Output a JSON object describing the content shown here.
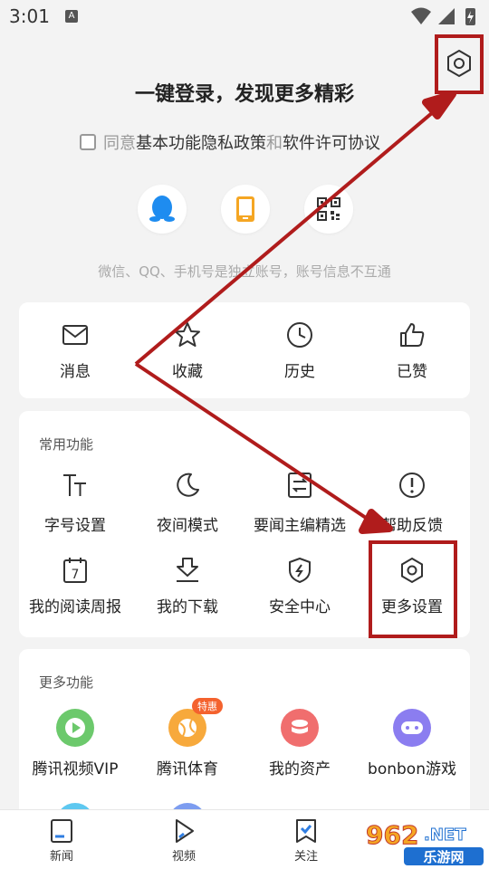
{
  "status_bar": {
    "time": "3:01",
    "notif_letter": "A"
  },
  "login": {
    "title": "一键登录，发现更多精彩",
    "agree_prefix": "同意",
    "agree_link1": "基本功能隐私政策",
    "agree_and": "和",
    "agree_link2": "软件许可协议",
    "methods": [
      {
        "name": "qq",
        "icon": "qq-penguin-icon",
        "color": "#1e8cf0"
      },
      {
        "name": "phone",
        "icon": "phone-icon",
        "color": "#f5a623"
      },
      {
        "name": "qr",
        "icon": "qr-code-icon",
        "color": "#333333"
      }
    ],
    "note": "微信、QQ、手机号是独立账号，账号信息不互通"
  },
  "quick": [
    {
      "label": "消息",
      "icon": "mail-icon"
    },
    {
      "label": "收藏",
      "icon": "star-icon"
    },
    {
      "label": "历史",
      "icon": "clock-icon"
    },
    {
      "label": "已赞",
      "icon": "thumbs-up-icon"
    }
  ],
  "common": {
    "title": "常用功能",
    "items": [
      {
        "label": "字号设置",
        "icon": "font-size-icon"
      },
      {
        "label": "夜间模式",
        "icon": "moon-icon"
      },
      {
        "label": "要闻主编精选",
        "icon": "swap-list-icon"
      },
      {
        "label": "帮助反馈",
        "icon": "info-icon"
      },
      {
        "label": "我的阅读周报",
        "icon": "calendar-icon",
        "calendar_day": "7"
      },
      {
        "label": "我的下载",
        "icon": "download-icon"
      },
      {
        "label": "安全中心",
        "icon": "shield-icon"
      },
      {
        "label": "更多设置",
        "icon": "hexagon-settings-icon"
      }
    ]
  },
  "more": {
    "title": "更多功能",
    "items": [
      {
        "label": "腾讯视频VIP",
        "icon": "play-icon",
        "color": "#6cc96c"
      },
      {
        "label": "腾讯体育",
        "icon": "ball-icon",
        "color": "#f7a93c",
        "badge": "特惠"
      },
      {
        "label": "我的资产",
        "icon": "wallet-icon",
        "color": "#f06e6e"
      },
      {
        "label": "bonbon游戏",
        "icon": "gamepad-icon",
        "color": "#8b7df0"
      }
    ]
  },
  "tabbar": [
    {
      "label": "新闻",
      "icon": "news-icon"
    },
    {
      "label": "视频",
      "icon": "video-icon"
    },
    {
      "label": "关注",
      "icon": "follow-icon"
    }
  ],
  "watermark": {
    "number": "962",
    "suffix": ".NET",
    "site": "乐游网"
  },
  "colors": {
    "accent_red": "#b01c1c",
    "background": "#f3f3f3",
    "card": "#ffffff"
  }
}
